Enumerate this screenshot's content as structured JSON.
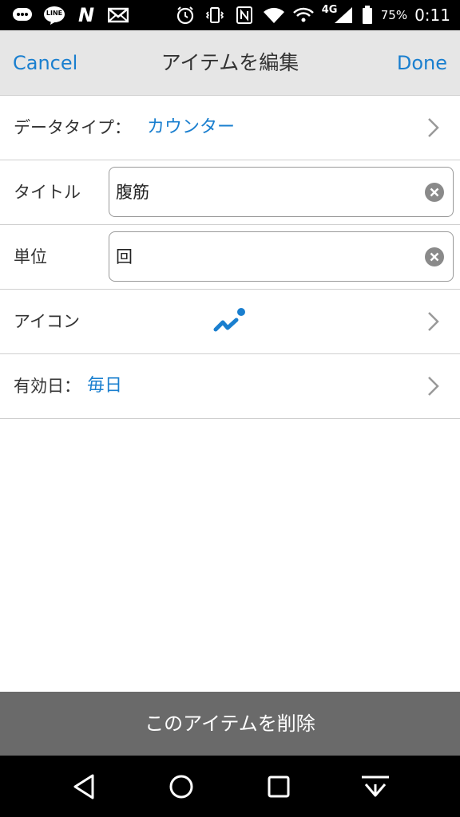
{
  "status_bar": {
    "battery_percent": "75%",
    "network": "4G",
    "time": "0:11",
    "left_icons": [
      "chat-bubble-icon",
      "line-app-icon",
      "n-app-icon",
      "mail-icon"
    ],
    "right_icons": [
      "alarm-icon",
      "vibrate-icon",
      "nfc-icon",
      "wifi-icon",
      "wifi-icon",
      "signal-icon",
      "battery-icon"
    ],
    "line_label": "LINE",
    "n_label": "N"
  },
  "header": {
    "cancel_label": "Cancel",
    "title": "アイテムを編集",
    "done_label": "Done"
  },
  "form": {
    "data_type": {
      "label": "データタイプ：",
      "value": "カウンター"
    },
    "title": {
      "label": "タイトル",
      "value": "腹筋"
    },
    "unit": {
      "label": "単位",
      "value": "回"
    },
    "icon": {
      "label": "アイコン",
      "icon_name": "fitness-squiggle-icon"
    },
    "valid_days": {
      "label": "有効日：",
      "value": "毎日"
    }
  },
  "delete_button_label": "このアイテムを削除",
  "android_nav": [
    "back-icon",
    "home-icon",
    "recents-icon",
    "hide-nav-icon"
  ],
  "colors": {
    "accent": "#1a7fcf",
    "header_bg": "#e6e6e6",
    "delete_bg": "#6a6a6a"
  }
}
